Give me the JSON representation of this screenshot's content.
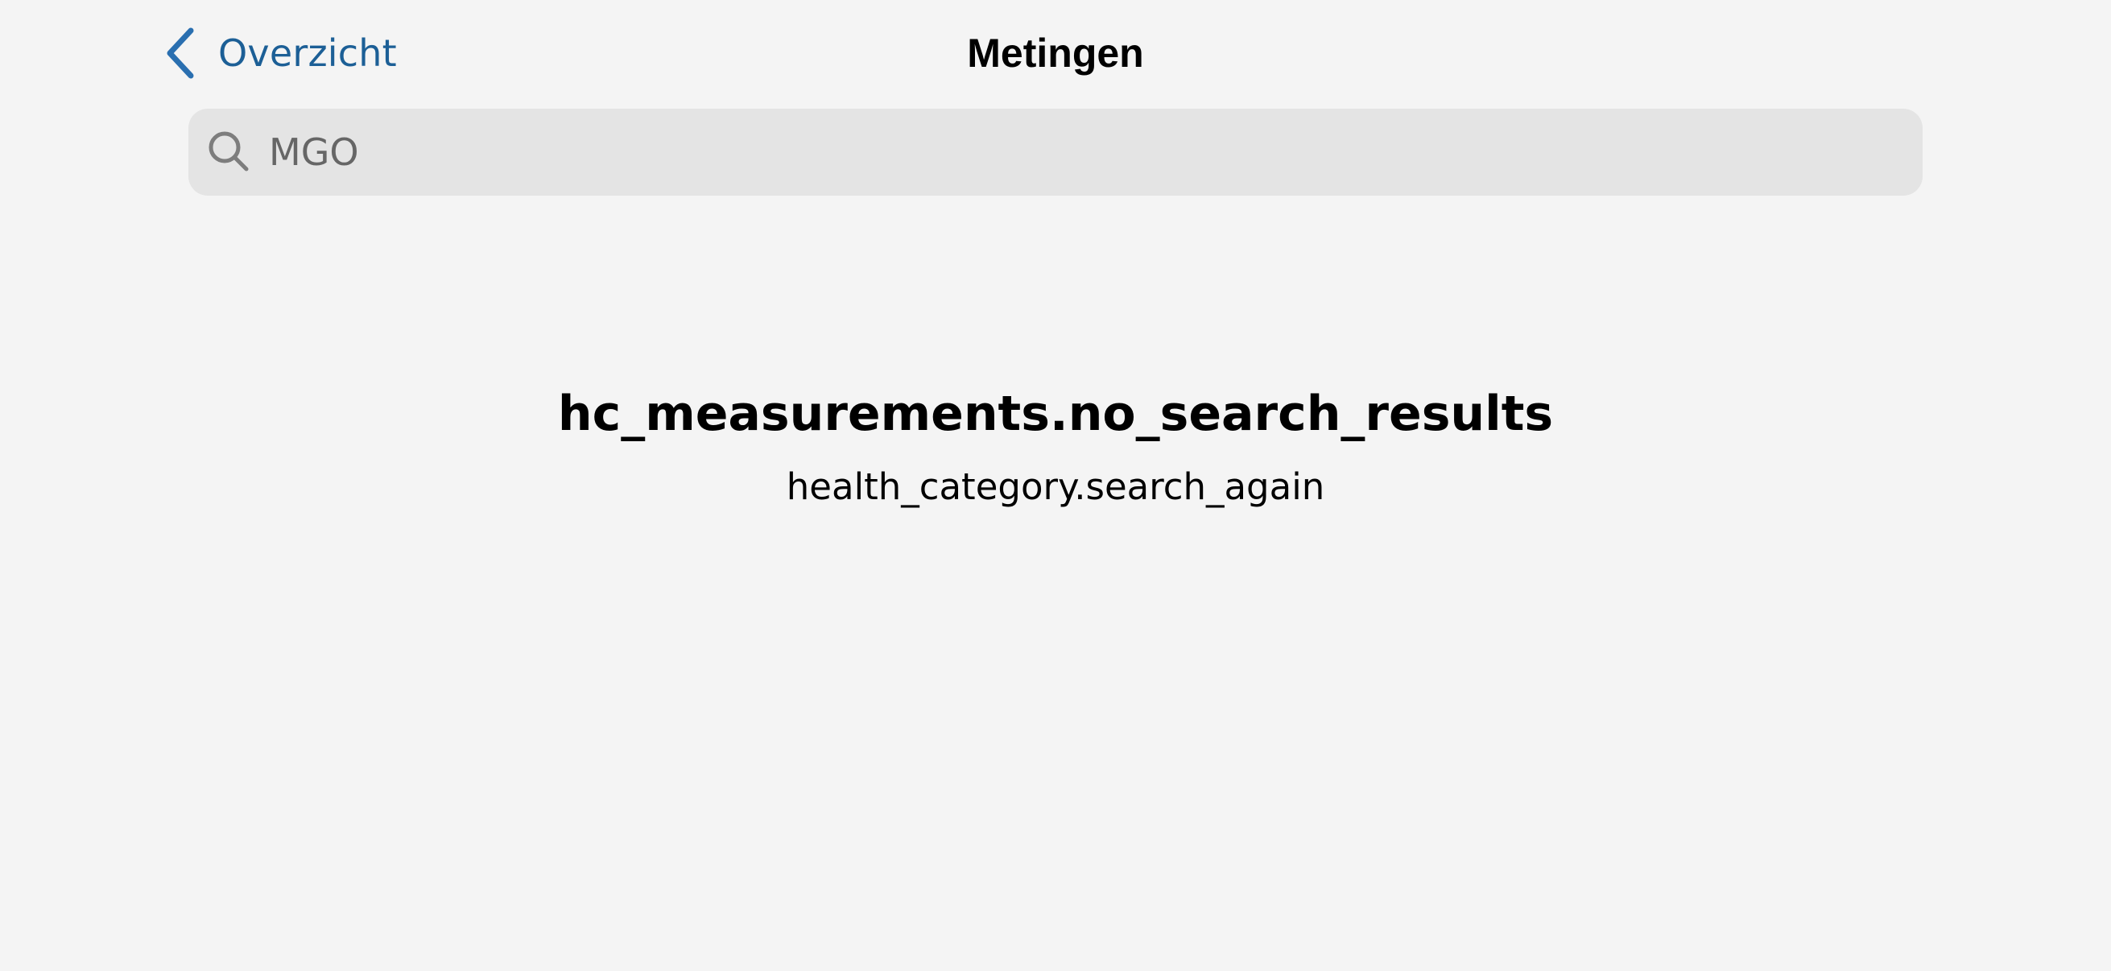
{
  "nav": {
    "back_label": "Overzicht",
    "title": "Metingen"
  },
  "search": {
    "value": "MGO",
    "icon": "search-icon"
  },
  "empty_state": {
    "title": "hc_measurements.no_search_results",
    "subtitle": "health_category.search_again"
  },
  "colors": {
    "background": "#f4f4f4",
    "accent": "#1c5f96",
    "search_field": "#e4e4e4"
  }
}
